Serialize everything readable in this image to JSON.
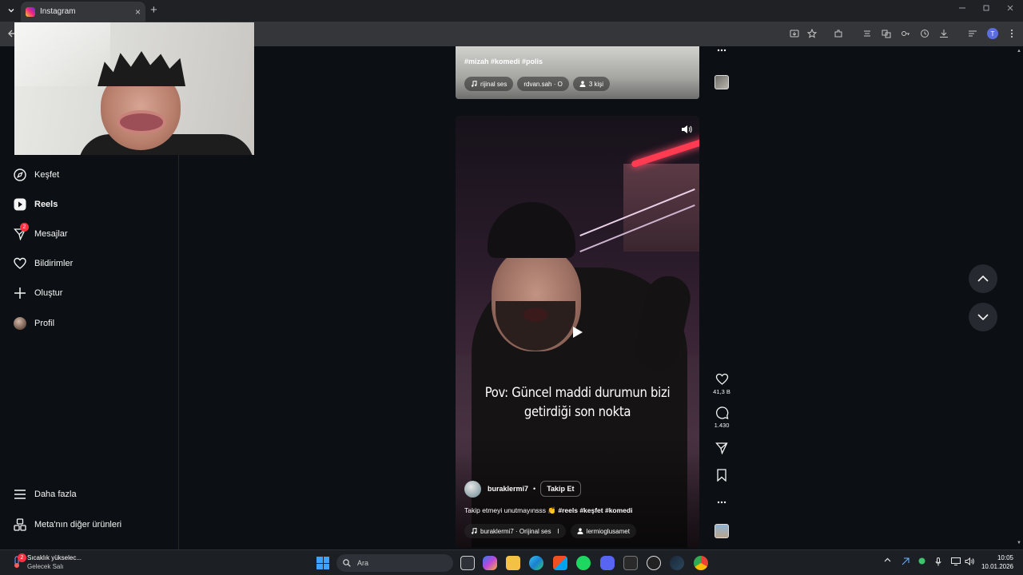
{
  "browser": {
    "tab_title": "Instagram",
    "tab_close": "×",
    "new_tab": "+",
    "profile_initial": "T"
  },
  "sidebar": {
    "items": [
      {
        "label": "Keşfet",
        "icon": "compass-icon"
      },
      {
        "label": "Reels",
        "icon": "reels-icon"
      },
      {
        "label": "Mesajlar",
        "icon": "messages-icon",
        "badge": "2"
      },
      {
        "label": "Bildirimler",
        "icon": "heart-icon"
      },
      {
        "label": "Oluştur",
        "icon": "plus-icon"
      },
      {
        "label": "Profil",
        "icon": "avatar"
      }
    ],
    "more_label": "Daha fazla",
    "meta_label": "Meta'nın diğer ürünleri"
  },
  "prev_reel": {
    "tags": "#mizah #komedi #polis",
    "audio": "rijinal ses",
    "audio_user": "rdvan.sah · O",
    "people": "3 kişi"
  },
  "reel": {
    "caption_line1": "Pov: Güncel maddi durumun bizi",
    "caption_line2": "getirdiği son nokta",
    "username": "buraklermi7",
    "dot": "•",
    "follow_label": "Takip Et",
    "description_prefix": "Takip etmeyi unutmayınsss 👏",
    "description_tags": "#reels #keşfet #komedi",
    "audio": "buraklermi7 · Orijinal ses",
    "audio_sep": "I",
    "tagged_user": "lermioglusamet"
  },
  "actions": {
    "likes": "41,3 B",
    "comments": "1.430"
  },
  "taskbar": {
    "weather_title": "Sıcaklık yükselec...",
    "weather_sub": "Gelecek Salı",
    "weather_badge": "2",
    "search_placeholder": "Ara",
    "time": "10:05",
    "date": "10.01.2026"
  }
}
